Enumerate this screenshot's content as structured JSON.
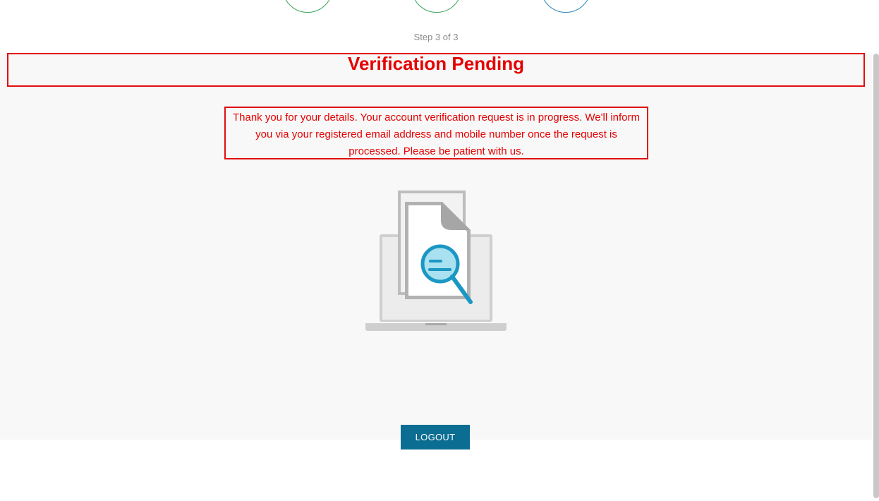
{
  "stepper": {
    "steps": [
      {
        "status": "complete",
        "color": "#3aa35a",
        "icon": "step-circle"
      },
      {
        "status": "complete",
        "color": "#3aa35a",
        "icon": "step-circle"
      },
      {
        "status": "current",
        "color": "#2a86b5",
        "icon": "step-circle"
      }
    ],
    "indicator": "Step 3 of 3"
  },
  "main": {
    "title": "Verification Pending",
    "message": "Thank you for your details. Your account verification request is in progress. We'll inform you via your registered email address and mobile number once the request is processed. Please be patient with us.",
    "illustration_icon": "document-search-laptop-icon"
  },
  "actions": {
    "logout_label": "LOGOUT"
  },
  "colors": {
    "accent_red": "#e60000",
    "button_blue": "#0a6d91",
    "panel_bg": "#f8f8f8"
  }
}
